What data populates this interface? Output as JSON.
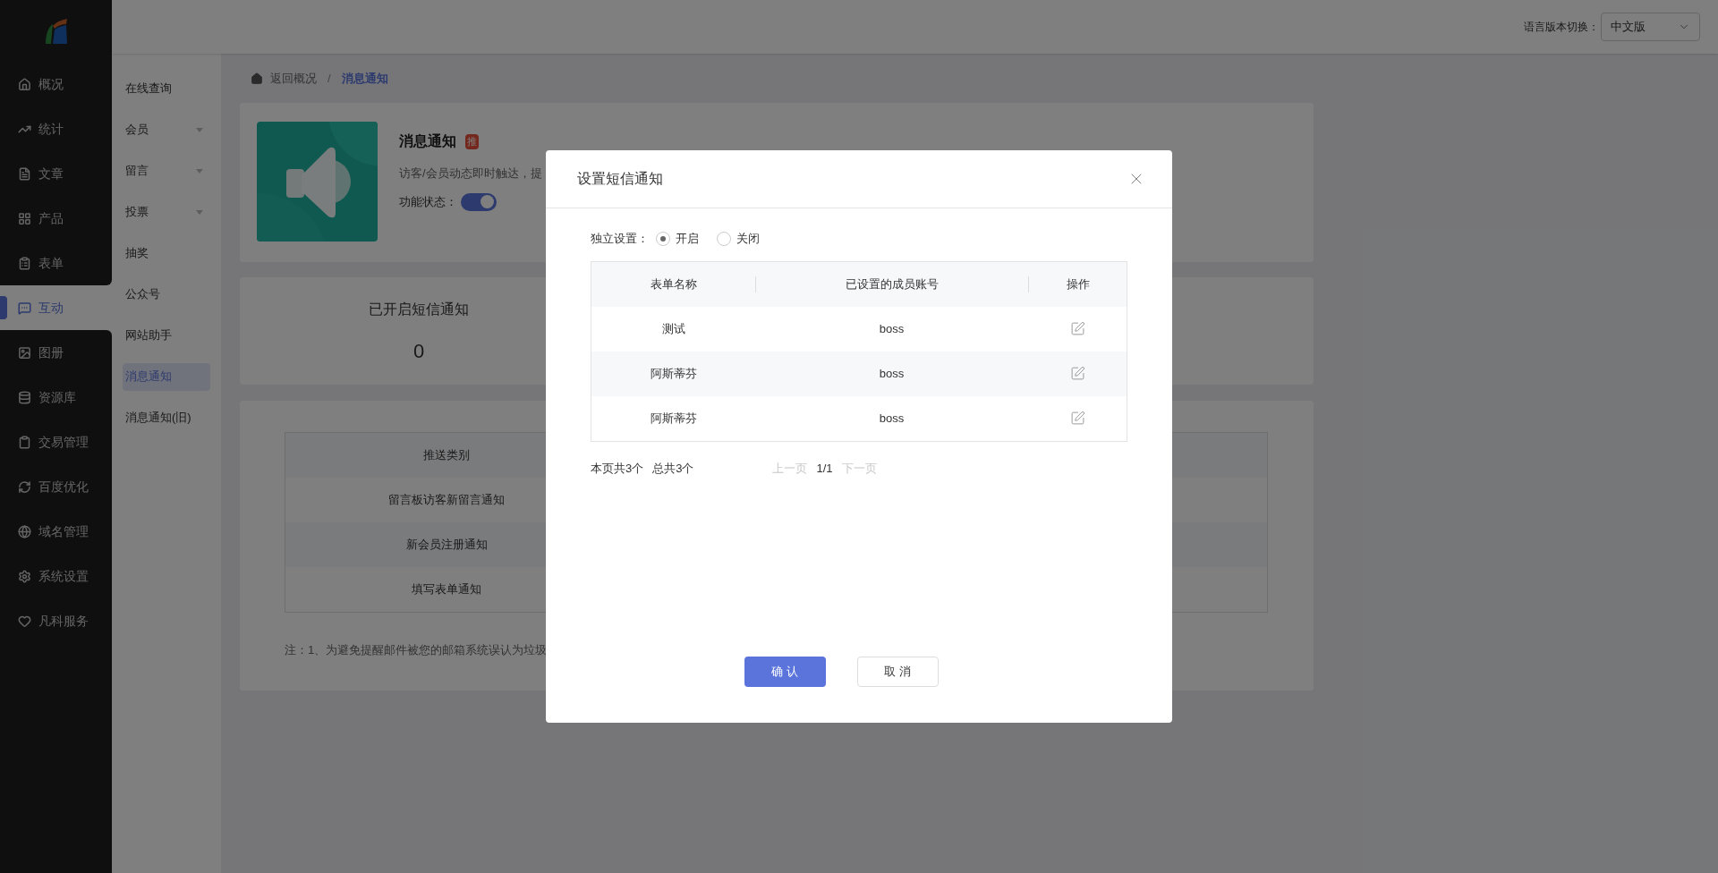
{
  "top_bar": {
    "language_label": "语言版本切换：",
    "language_select": "中文版"
  },
  "sidebar": {
    "items": [
      {
        "label": "概况",
        "selected": false
      },
      {
        "label": "统计",
        "selected": false
      },
      {
        "label": "文章",
        "selected": false
      },
      {
        "label": "产品",
        "selected": false
      },
      {
        "label": "表单",
        "selected": false
      },
      {
        "label": "互动",
        "selected": true
      },
      {
        "label": "图册",
        "selected": false
      },
      {
        "label": "资源库",
        "selected": false
      },
      {
        "label": "交易管理",
        "selected": false
      },
      {
        "label": "百度优化",
        "selected": false
      },
      {
        "label": "域名管理",
        "selected": false
      },
      {
        "label": "系统设置",
        "selected": false
      },
      {
        "label": "凡科服务",
        "selected": false
      }
    ]
  },
  "submenu": {
    "items": [
      {
        "label": "在线查询",
        "expandable": false,
        "selected": false
      },
      {
        "label": "会员",
        "expandable": true,
        "selected": false
      },
      {
        "label": "留言",
        "expandable": true,
        "selected": false
      },
      {
        "label": "投票",
        "expandable": true,
        "selected": false
      },
      {
        "label": "抽奖",
        "expandable": false,
        "selected": false
      },
      {
        "label": "公众号",
        "expandable": false,
        "selected": false
      },
      {
        "label": "网站助手",
        "expandable": false,
        "selected": false
      },
      {
        "label": "消息通知",
        "expandable": false,
        "selected": true
      },
      {
        "label": "消息通知(旧)",
        "expandable": false,
        "selected": false
      }
    ]
  },
  "breadcrumb": {
    "back": "返回概况",
    "separator": "/",
    "current": "消息通知"
  },
  "feature": {
    "title": "消息通知",
    "badge": "推",
    "description": "访客/会员动态即时触达，提",
    "status_label": "功能状态：",
    "enabled": true
  },
  "stats": [
    {
      "label": "已开启短信通知",
      "value": "0"
    }
  ],
  "push_table": {
    "header": "推送类别",
    "rows": [
      "留言板访客新留言通知",
      "新会员注册通知",
      "填写表单通知"
    ]
  },
  "note": "注：1、为避免提醒邮件被您的邮箱系统误认为垃圾",
  "dialog": {
    "title": "设置短信通知",
    "independent_label": "独立设置：",
    "options": [
      {
        "label": "开启",
        "selected": true
      },
      {
        "label": "关闭",
        "selected": false
      }
    ],
    "table": {
      "columns": [
        "表单名称",
        "已设置的成员账号",
        "操作"
      ],
      "rows": [
        {
          "form": "测试",
          "account": "boss"
        },
        {
          "form": "阿斯蒂芬",
          "account": "boss"
        },
        {
          "form": "阿斯蒂芬",
          "account": "boss"
        }
      ]
    },
    "page_count": "本页共3个",
    "total": "总共3个",
    "prev": {
      "label": "上一页",
      "disabled": true
    },
    "page": "1/1",
    "next": {
      "label": "下一页",
      "disabled": true
    },
    "buttons": [
      {
        "label": "确 认",
        "kind": "primary"
      },
      {
        "label": "取 消",
        "kind": "default"
      }
    ]
  }
}
